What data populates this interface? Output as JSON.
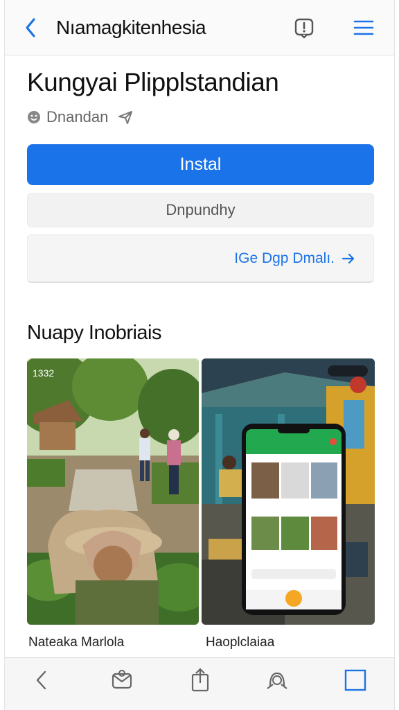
{
  "header": {
    "title": "Nıamagkitenhesia"
  },
  "app": {
    "name": "Kungyai Plipplstandian",
    "developer": "Dnandan"
  },
  "buttons": {
    "install": "Instal",
    "secondary": "Dnpundhy",
    "link": "IGe Dgp Dmalı."
  },
  "screenshots": {
    "section_title": "Nuapy Inobriais",
    "items": [
      {
        "caption": "Nateaka Marlola",
        "badge": "1332"
      },
      {
        "caption": "Haoplclaiaa"
      }
    ]
  },
  "icons": {
    "back": "chevron-left-icon",
    "bookmark": "flag-icon",
    "menu": "hamburger-icon",
    "developer": "smiley-icon",
    "share": "send-icon",
    "link_arrow": "arrow-right-icon",
    "toolbar": [
      "chevron-left-icon",
      "mail-icon",
      "share-icon",
      "bookmark-icon",
      "tabs-icon"
    ]
  },
  "colors": {
    "accent": "#1a73e8",
    "app_green": "#22a94f"
  }
}
